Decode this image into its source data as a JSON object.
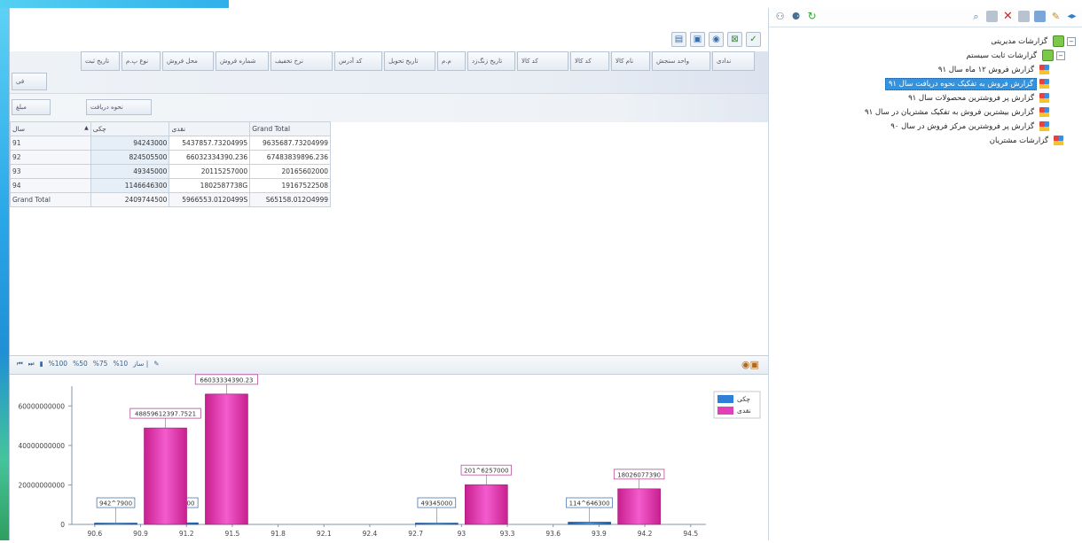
{
  "toolbar_top": {
    "icons": [
      "eye-icon",
      "eye-icon",
      "refresh-icon",
      "find-icon",
      "copy-icon",
      "delete-icon",
      "grid-icon",
      "export-icon",
      "brush-icon",
      "arrows-icon"
    ]
  },
  "tree": {
    "root": "گزارشات مدیریتی",
    "group": "گزارشات ثابت سیستم",
    "items": [
      "گزارش فروش ۱۲ ماه سال ۹۱",
      "گزارش فروش به تفکیک نحوه دریافت سال ۹۱",
      "گزارش پر فروشترین محصولات سال ۹۱",
      "گزارش بیشترین فروش به تفکیک مشتریان در سال ۹۱",
      "گزارش پر فروشترین مرکز فروش در سال ۹۰"
    ],
    "last": "گزارشات مشتریان",
    "selected_index": 1
  },
  "pivot": {
    "filter_headers": [
      "ندادی",
      "واحد سنجش",
      "نام کالا",
      "کد کالا",
      "کد کالا",
      "تاریخ زنگ‌زد",
      "م.م",
      "تاریخ تحویل",
      "کد آدرس",
      "نرخ تخفیف",
      "شماره فروش",
      "محل فروش",
      "نوع پ.م",
      "تاریخ ثبت"
    ],
    "filter_header2": "فی",
    "row_area_labels": [
      "مبلغ",
      "نحوه دریافت"
    ],
    "row_header": "سال",
    "columns": [
      "چکی",
      "نقدی",
      "Grand Total"
    ],
    "rows": [
      {
        "year": "91",
        "values": [
          "94243000",
          "5437857.73204995",
          "9635687.73204999"
        ]
      },
      {
        "year": "92",
        "values": [
          "824505500",
          "66032334390.236",
          "67483839896.236"
        ]
      },
      {
        "year": "93",
        "values": [
          "49345000",
          "20115257000",
          "20165602000"
        ]
      },
      {
        "year": "94",
        "values": [
          "1146646300",
          "1802587738G",
          "19167522508"
        ]
      }
    ],
    "grand_total": {
      "label": "Grand Total",
      "values": [
        "2409744500",
        "5966553.0120499S",
        "S65158.012O4999"
      ]
    }
  },
  "chart_toolbar": {
    "items": [
      "%100",
      "%50",
      "%75",
      "%10",
      "ساز |"
    ]
  },
  "chart_data": {
    "type": "bar",
    "x": [
      90.9,
      91.3,
      93.0,
      94.0
    ],
    "series": [
      {
        "name": "چکی",
        "values": [
          942900,
          824505500,
          49345000,
          1146646300
        ],
        "color": "#2f7fd8"
      },
      {
        "name": "نقدی",
        "values": [
          48859612397,
          66033334390,
          20115257000,
          18026077390
        ],
        "color": "#e23fb8"
      }
    ],
    "bar_labels": {
      "s0": [
        "942^7900",
        "E24505500",
        "49345000",
        "114^646300"
      ],
      "s1": [
        "48859612397.7521",
        "66033334390.23",
        "201^6257000",
        "18026077390"
      ]
    },
    "x_ticks": [
      "90.6",
      "90.9",
      "91.2",
      "91.5",
      "91.8",
      "92.1",
      "92.4",
      "92.7",
      "93",
      "93.3",
      "93.6",
      "93.9",
      "94.2",
      "94.5"
    ],
    "y_ticks": [
      "0",
      "20000000000",
      "40000000000",
      "60000000000"
    ],
    "ylim": [
      0,
      70000000000
    ],
    "xlim": [
      90.45,
      94.6
    ],
    "legend_placement": "top-right",
    "grid": false
  }
}
